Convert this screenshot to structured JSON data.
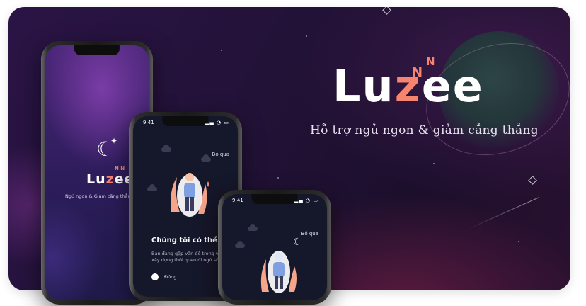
{
  "brand": {
    "logo_text_pre": "Lu",
    "logo_text_z": "z",
    "logo_text_post": "ee",
    "zz_mark": "N",
    "tagline": "Hỗ trợ ngủ ngon & giảm cẳng thẳng"
  },
  "phone_splash": {
    "logo_text_pre": "Lu",
    "logo_text_z": "z",
    "logo_text_post": "ee",
    "zz_mark": "N N",
    "tagline": "Ngủ ngon & Giảm căng thẳng",
    "moon_icon": "crescent-moon-icon"
  },
  "phone_question": {
    "time": "9:41",
    "skip_label": "Bỏ qua",
    "question_title": "Chúng tôi có thể giúp gì?",
    "question_desc": "Bạn đang gặp vấn đề trong việc xây dựng thói quen đi ngủ sớm",
    "option_label": "Đúng"
  },
  "phone_third": {
    "time": "9:41",
    "skip_label": "Bỏ qua"
  },
  "colors": {
    "accent": "#f7846f",
    "background": "#231238",
    "screen": "#15172a"
  }
}
